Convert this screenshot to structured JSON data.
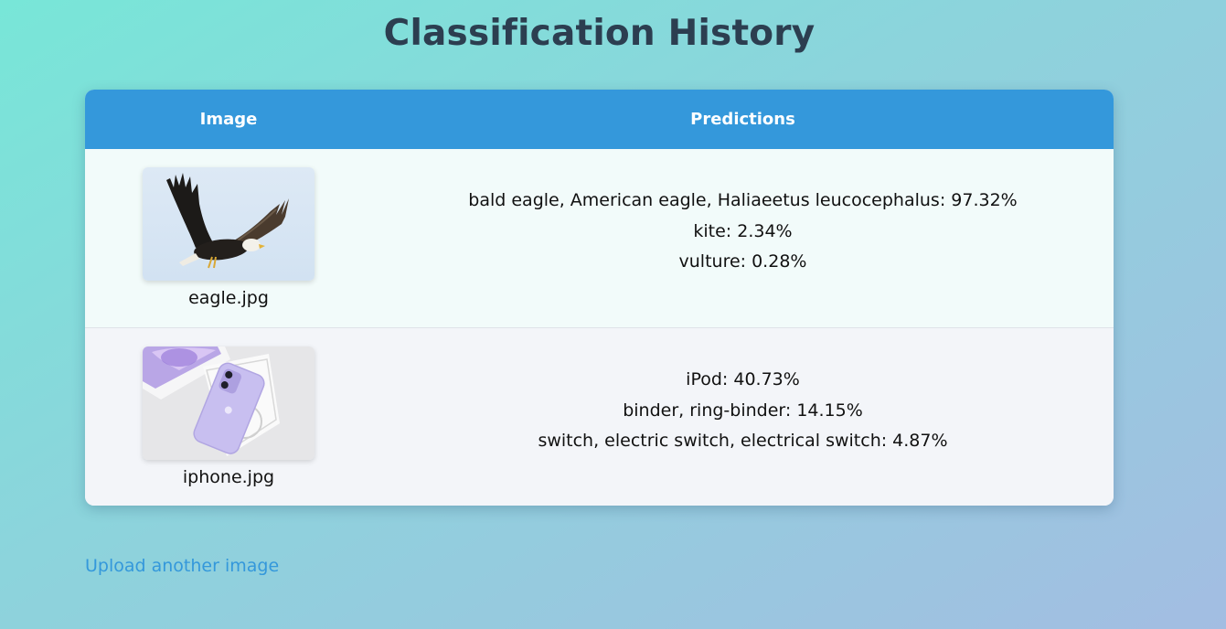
{
  "page": {
    "title": "Classification History"
  },
  "table": {
    "headers": {
      "image": "Image",
      "predictions": "Predictions"
    },
    "rows": [
      {
        "filename": "eagle.jpg",
        "thumbnail": "eagle-photo",
        "predictions": [
          "bald eagle, American eagle, Haliaeetus leucocephalus: 97.32%",
          "kite: 2.34%",
          "vulture: 0.28%"
        ]
      },
      {
        "filename": "iphone.jpg",
        "thumbnail": "iphone-photo",
        "predictions": [
          "iPod: 40.73%",
          "binder, ring-binder: 14.15%",
          "switch, electric switch, electrical switch: 4.87%"
        ]
      }
    ]
  },
  "links": {
    "upload_another": "Upload another image"
  },
  "colors": {
    "header_bg": "#3498db",
    "title": "#2c3e50",
    "link": "#3498db"
  }
}
